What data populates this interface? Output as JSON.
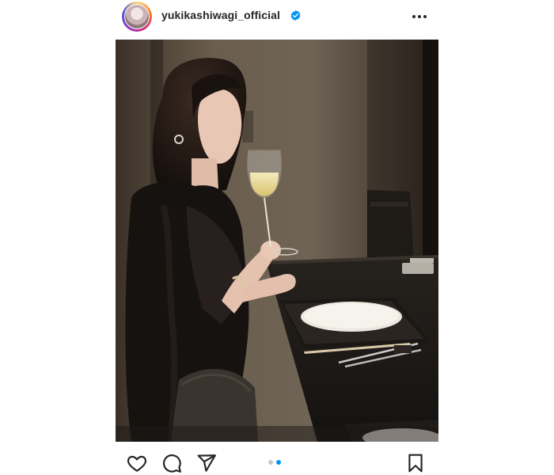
{
  "post": {
    "username": "yukikashiwagi_official",
    "verified": true,
    "photo_alt": "",
    "carousel": {
      "total": 2,
      "current": 2
    }
  },
  "icons": {
    "verified": "verified-badge-icon",
    "more": "more-options-icon",
    "like": "heart-icon",
    "comment": "comment-icon",
    "share": "paper-plane-icon",
    "save": "bookmark-icon"
  },
  "colors": {
    "accent": "#0095f6",
    "text": "#262626",
    "dot_inactive": "#c7c7c7"
  }
}
